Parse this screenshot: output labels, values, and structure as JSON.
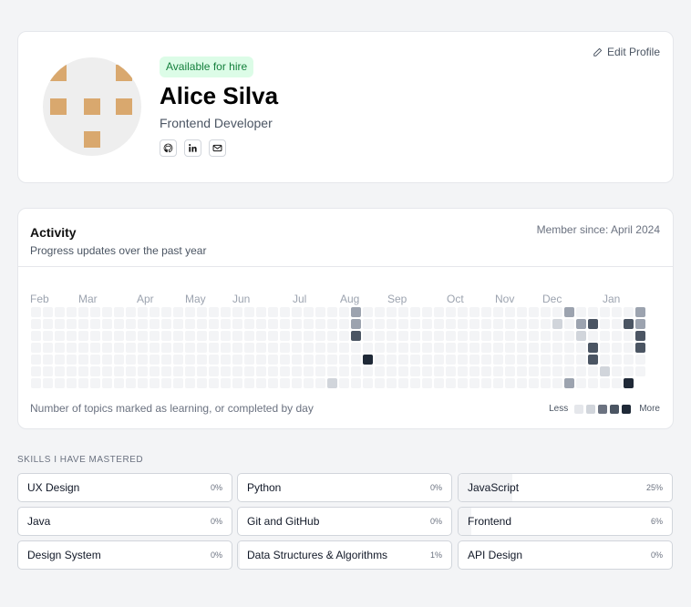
{
  "profile": {
    "badge": "Available for hire",
    "name": "Alice Silva",
    "role": "Frontend Developer",
    "edit_label": "Edit Profile",
    "socials": [
      "github-icon",
      "linkedin-icon",
      "mail-icon"
    ],
    "avatar_color": "#d9a86e"
  },
  "activity": {
    "title": "Activity",
    "subtitle": "Progress updates over the past year",
    "member_since": "Member since: April 2024",
    "months": [
      "Feb",
      "Mar",
      "Apr",
      "May",
      "Jun",
      "Jul",
      "Aug",
      "Sep",
      "Oct",
      "Nov",
      "Dec",
      "Jan"
    ],
    "footer": "Number of topics marked as learning, or completed by day",
    "legend_less": "Less",
    "legend_more": "More",
    "levels": [
      "#f3f4f6",
      "#d1d5db",
      "#9ca3af",
      "#6b7280",
      "#4b5563",
      "#1f2937"
    ],
    "highlights": [
      {
        "week": 27,
        "day": 0,
        "level": 2
      },
      {
        "week": 27,
        "day": 1,
        "level": 2
      },
      {
        "week": 27,
        "day": 2,
        "level": 4
      },
      {
        "week": 28,
        "day": 4,
        "level": 5
      },
      {
        "week": 25,
        "day": 6,
        "level": 1
      },
      {
        "week": 44,
        "day": 1,
        "level": 1
      },
      {
        "week": 45,
        "day": 0,
        "level": 2
      },
      {
        "week": 46,
        "day": 1,
        "level": 2
      },
      {
        "week": 46,
        "day": 2,
        "level": 1
      },
      {
        "week": 47,
        "day": 1,
        "level": 4
      },
      {
        "week": 47,
        "day": 3,
        "level": 4
      },
      {
        "week": 47,
        "day": 4,
        "level": 4
      },
      {
        "week": 48,
        "day": 5,
        "level": 1
      },
      {
        "week": 45,
        "day": 6,
        "level": 2
      },
      {
        "week": 50,
        "day": 1,
        "level": 4
      },
      {
        "week": 50,
        "day": 6,
        "level": 5
      },
      {
        "week": 51,
        "day": 0,
        "level": 2
      },
      {
        "week": 51,
        "day": 1,
        "level": 2
      },
      {
        "week": 51,
        "day": 2,
        "level": 4
      },
      {
        "week": 51,
        "day": 3,
        "level": 4
      }
    ]
  },
  "skills": {
    "title": "SKILLS I HAVE MASTERED",
    "items": [
      {
        "name": "UX Design",
        "percent": "0%",
        "value": 0
      },
      {
        "name": "Python",
        "percent": "0%",
        "value": 0
      },
      {
        "name": "JavaScript",
        "percent": "25%",
        "value": 25
      },
      {
        "name": "Java",
        "percent": "0%",
        "value": 0
      },
      {
        "name": "Git and GitHub",
        "percent": "0%",
        "value": 0
      },
      {
        "name": "Frontend",
        "percent": "6%",
        "value": 6
      },
      {
        "name": "Design System",
        "percent": "0%",
        "value": 0
      },
      {
        "name": "Data Structures & Algorithms",
        "percent": "1%",
        "value": 1
      },
      {
        "name": "API Design",
        "percent": "0%",
        "value": 0
      }
    ]
  }
}
